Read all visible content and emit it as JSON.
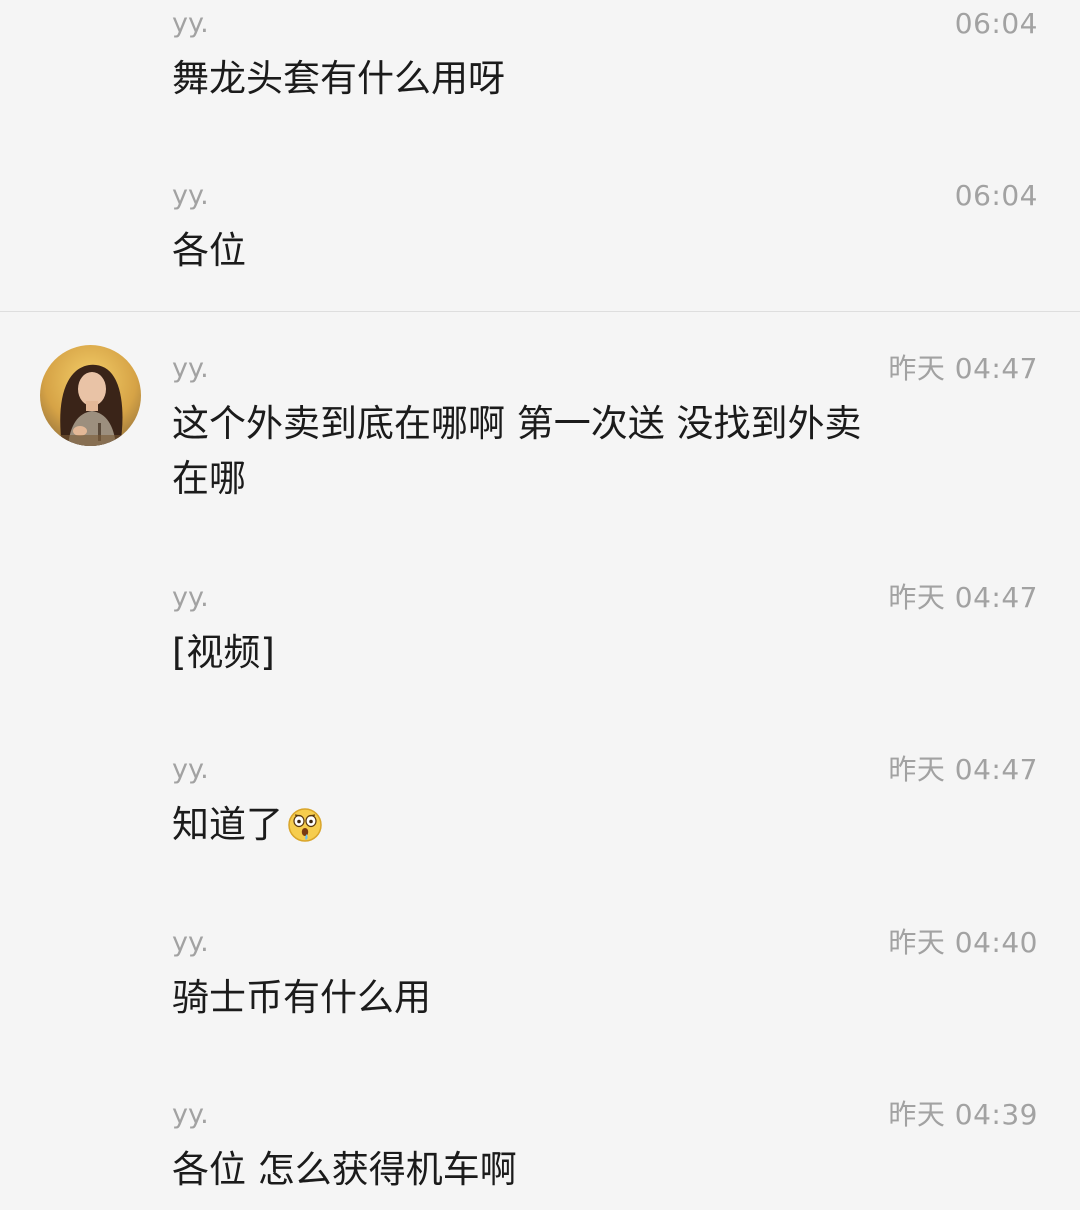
{
  "chat": {
    "groups": [
      {
        "messages": [
          {
            "sender": "yy.",
            "time": "06:04",
            "text": "舞龙头套有什么用呀"
          },
          {
            "sender": "yy.",
            "time": "06:04",
            "text": "各位"
          }
        ]
      },
      {
        "messages": [
          {
            "sender": "yy.",
            "time": "昨天 04:47",
            "text": "这个外卖到底在哪啊 第一次送 没找到外卖在哪"
          },
          {
            "sender": "yy.",
            "time": "昨天 04:47",
            "text": "[视频]"
          },
          {
            "sender": "yy.",
            "time": "昨天 04:47",
            "text": "知道了",
            "emoji": "astonished-face-icon"
          },
          {
            "sender": "yy.",
            "time": "昨天 04:40",
            "text": "骑士币有什么用"
          },
          {
            "sender": "yy.",
            "time": "昨天 04:39",
            "text": "各位 怎么获得机车啊"
          }
        ]
      }
    ]
  },
  "colors": {
    "background": "#f5f5f5",
    "sender": "#a2a2a2",
    "time": "#a2a2a2",
    "message_text": "#1b1b1b",
    "divider": "#dedede"
  }
}
